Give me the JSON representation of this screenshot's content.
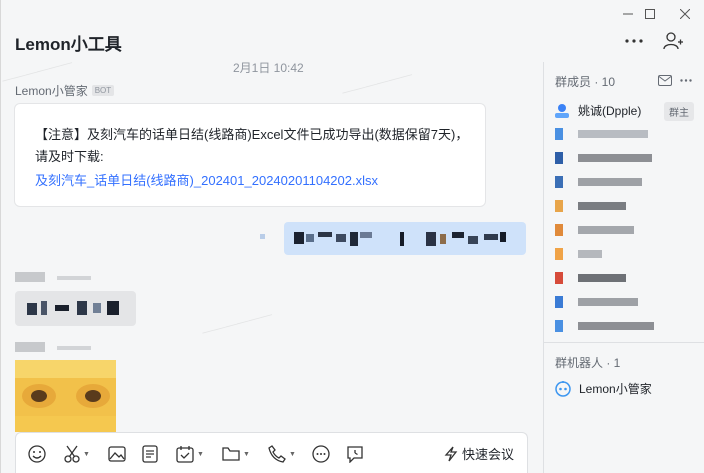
{
  "window": {
    "title": "Lemon小工具"
  },
  "chat": {
    "timestamp": "2月1日 10:42",
    "sender": "Lemon小管家",
    "bot_badge": "BOT",
    "card": {
      "text": "【注意】及刻汽车的话单日结(线路商)Excel文件已成功导出(数据保留7天)，请及时下载:",
      "link": "及刻汽车_话单日结(线路商)_202401_20240201104202.xlsx"
    }
  },
  "toolbar": {
    "items": [
      "emoji-icon",
      "scissors-icon",
      "image-icon",
      "document-icon",
      "calendar-check-icon",
      "folder-icon",
      "phone-icon",
      "more-icon",
      "clock-chat-icon"
    ],
    "quick_meeting_label": "快速会议"
  },
  "sidebar": {
    "members_header": "群成员 · 10",
    "members": [
      {
        "name": "姚诚(Dpple)",
        "badge": "群主"
      }
    ],
    "bots_header": "群机器人 · 1",
    "bots": [
      {
        "name": "Lemon小管家"
      }
    ]
  }
}
